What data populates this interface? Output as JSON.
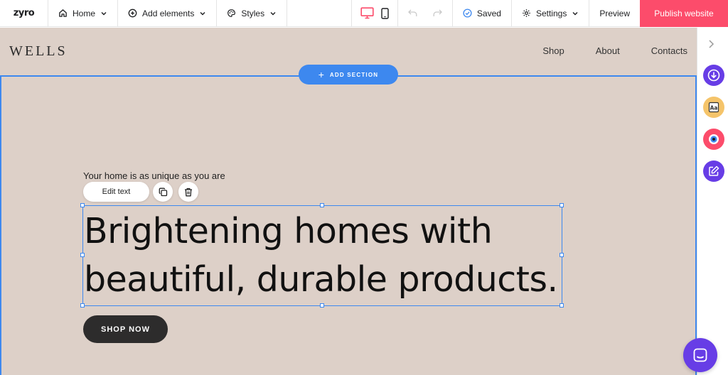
{
  "toolbar": {
    "logo": "zyro",
    "page_selector": "Home",
    "add_elements": "Add elements",
    "styles": "Styles",
    "saved": "Saved",
    "settings": "Settings",
    "preview": "Preview",
    "publish": "Publish website"
  },
  "site": {
    "brand": "WELLS",
    "nav": [
      "Shop",
      "About",
      "Contacts"
    ]
  },
  "editor": {
    "add_section": "ADD SECTION",
    "edit_text": "Edit text"
  },
  "hero": {
    "tagline": "Your home is as unique as you are",
    "headline_line1": "Brightening homes with",
    "headline_line2": "beautiful, durable products.",
    "cta": "SHOP NOW"
  },
  "colors": {
    "accent": "#3d88ef",
    "publish": "#fc4c6b",
    "canvas_bg": "#ddd0c8",
    "active_device": "#fc4c6b",
    "brand_purple": "#673de6"
  },
  "icons": {
    "sidebar": [
      "download-icon",
      "typography-icon",
      "color-palette-icon",
      "edit-icon"
    ]
  }
}
